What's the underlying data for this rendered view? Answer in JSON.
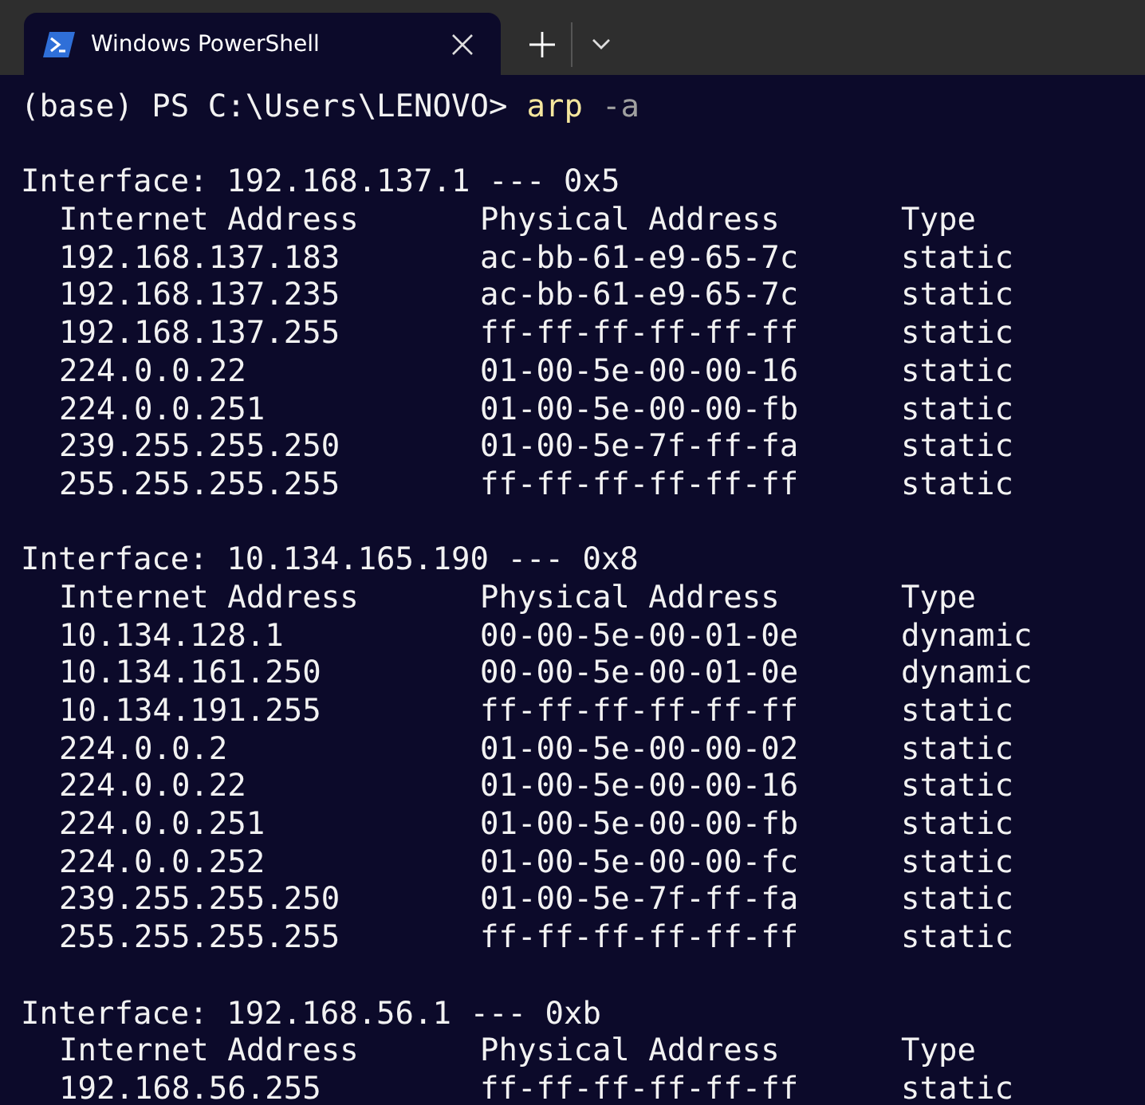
{
  "tab": {
    "title": "Windows PowerShell",
    "selected": true
  },
  "prompt": {
    "text": "(base) PS C:\\Users\\LENOVO>",
    "command": "arp",
    "argument": "-a"
  },
  "interfaces": [
    {
      "header": "Interface: 192.168.137.1 --- 0x5",
      "columns": [
        "Internet Address",
        "Physical Address",
        "Type"
      ],
      "rows": [
        [
          "192.168.137.183",
          "ac-bb-61-e9-65-7c",
          "static"
        ],
        [
          "192.168.137.235",
          "ac-bb-61-e9-65-7c",
          "static"
        ],
        [
          "192.168.137.255",
          "ff-ff-ff-ff-ff-ff",
          "static"
        ],
        [
          "224.0.0.22",
          "01-00-5e-00-00-16",
          "static"
        ],
        [
          "224.0.0.251",
          "01-00-5e-00-00-fb",
          "static"
        ],
        [
          "239.255.255.250",
          "01-00-5e-7f-ff-fa",
          "static"
        ],
        [
          "255.255.255.255",
          "ff-ff-ff-ff-ff-ff",
          "static"
        ]
      ]
    },
    {
      "header": "Interface: 10.134.165.190 --- 0x8",
      "columns": [
        "Internet Address",
        "Physical Address",
        "Type"
      ],
      "rows": [
        [
          "10.134.128.1",
          "00-00-5e-00-01-0e",
          "dynamic"
        ],
        [
          "10.134.161.250",
          "00-00-5e-00-01-0e",
          "dynamic"
        ],
        [
          "10.134.191.255",
          "ff-ff-ff-ff-ff-ff",
          "static"
        ],
        [
          "224.0.0.2",
          "01-00-5e-00-00-02",
          "static"
        ],
        [
          "224.0.0.22",
          "01-00-5e-00-00-16",
          "static"
        ],
        [
          "224.0.0.251",
          "01-00-5e-00-00-fb",
          "static"
        ],
        [
          "224.0.0.252",
          "01-00-5e-00-00-fc",
          "static"
        ],
        [
          "239.255.255.250",
          "01-00-5e-7f-ff-fa",
          "static"
        ],
        [
          "255.255.255.255",
          "ff-ff-ff-ff-ff-ff",
          "static"
        ]
      ]
    },
    {
      "header": "Interface: 192.168.56.1 --- 0xb",
      "columns": [
        "Internet Address",
        "Physical Address",
        "Type"
      ],
      "rows": [
        [
          "192.168.56.255",
          "ff-ff-ff-ff-ff-ff",
          "static"
        ]
      ]
    }
  ]
}
